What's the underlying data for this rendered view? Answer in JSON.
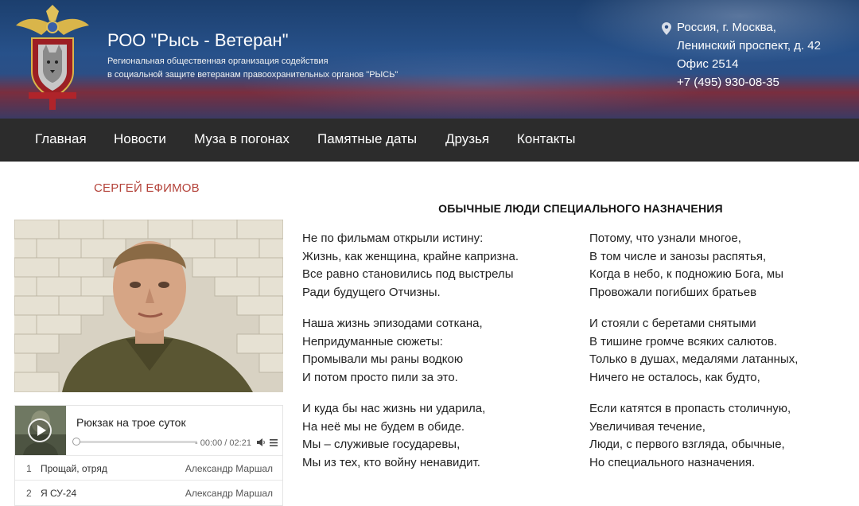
{
  "header": {
    "title": "РОО \"Рысь - Ветеран\"",
    "subtitle_line1": "Региональная общественная организация содействия",
    "subtitle_line2": "в социальной защите ветеранам правоохранительных органов \"РЫСЬ\"",
    "contact": {
      "line1": "Россия, г. Москва,",
      "line2": "Ленинский проспект, д. 42",
      "line3": "Офис 2514",
      "phone": "+7 (495) 930-08-35"
    }
  },
  "nav": {
    "items": [
      "Главная",
      "Новости",
      "Муза в погонах",
      "Памятные даты",
      "Друзья",
      "Контакты"
    ]
  },
  "author": "СЕРГЕЙ ЕФИМОВ",
  "player": {
    "current_track": "Рюкзак на трое суток",
    "time": "- 00:00 / 02:21",
    "progress": 0,
    "playlist": [
      {
        "num": "1",
        "title": "Прощай, отряд",
        "artist": "Александр Маршал"
      },
      {
        "num": "2",
        "title": "Я СУ-24",
        "artist": "Александр Маршал"
      }
    ]
  },
  "poem": {
    "title": "ОБЫЧНЫЕ ЛЮДИ СПЕЦИАЛЬНОГО НАЗНАЧЕНИЯ",
    "left_stanzas": [
      [
        "Не по фильмам открыли истину:",
        "Жизнь, как женщина, крайне капризна.",
        "Все равно становились под выстрелы",
        "Ради будущего Отчизны."
      ],
      [
        "Наша жизнь эпизодами соткана,",
        "Непридуманные сюжеты:",
        "Промывали мы раны водкою",
        "И потом просто пили за это."
      ],
      [
        "И куда бы нас жизнь ни ударила,",
        "На неё мы не будем в обиде.",
        "Мы – служивые государевы,",
        "Мы из тех, кто войну ненавидит."
      ]
    ],
    "right_stanzas": [
      [
        "Потому, что узнали многое,",
        "В том числе и занозы распятья,",
        "Когда в небо, к подножию Бога, мы",
        "Провожали погибших братьев"
      ],
      [
        "И стояли с беретами снятыми",
        "В тишине громче всяких салютов.",
        "Только в душах, медалями латанных,",
        "Ничего не осталось, как будто,"
      ],
      [
        "Если катятся в пропасть столичную,",
        "Увеличивая течение,",
        "Люди, с первого взгляда, обычные,",
        "Но специального назначения."
      ]
    ]
  },
  "colors": {
    "nav_bg": "#2c2c2c",
    "author": "#b4433a",
    "header_blue": "#27518a",
    "header_red": "#7a2e3e"
  },
  "icons": [
    "logo-emblem",
    "location-pin-icon",
    "play-icon",
    "volume-icon",
    "playlist-menu-icon"
  ]
}
